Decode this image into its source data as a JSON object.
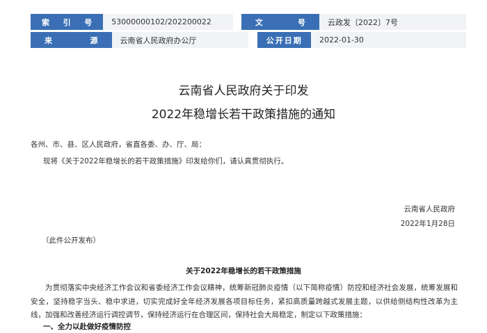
{
  "meta": {
    "index_label": [
      "索",
      "引",
      "号"
    ],
    "index_value": "53000000102/202200022",
    "doc_no_label": [
      "文",
      "号"
    ],
    "doc_no_value": "云政发〔2022〕7号",
    "source_label": [
      "来",
      "源"
    ],
    "source_value": "云南省人民政府办公厅",
    "publish_date_label": "公开日期",
    "publish_date_value": "2022-01-30"
  },
  "document": {
    "title_line1": "云南省人民政府关于印发",
    "title_line2": "2022年稳增长若干政策措施的通知",
    "salutation": "各州、市、县、区人民政府，省直各委、办、厅、局：",
    "notice": "现将《关于2022年稳增长的若干政策措施》印发给你们，请认真贯彻执行。",
    "signature_org": "云南省人民政府",
    "signature_date": "2022年1月28日",
    "release_note": "（此件公开发布）",
    "measures_title": "关于2022年稳增长的若干政策措施",
    "intro_paragraph": "为贯彻落实中央经济工作会议和省委经济工作会议精神，统筹新冠肺炎疫情（以下简称疫情）防控和经济社会发展，统筹发展和安全，坚持稳字当头、稳中求进，切实完成好全年经济发展各项目标任务，紧扣高质量跨越式发展主题，以供给侧结构性改革为主线，加强和改善经济运行调控调节，保持经济运行在合理区间，保持社会大局稳定，制定以下政策措施：",
    "section1_heading": "一、全力以赴做好疫情防控"
  },
  "colors": {
    "label_bg": "#3a6fb5",
    "value_bg": "#f1f3f6"
  }
}
